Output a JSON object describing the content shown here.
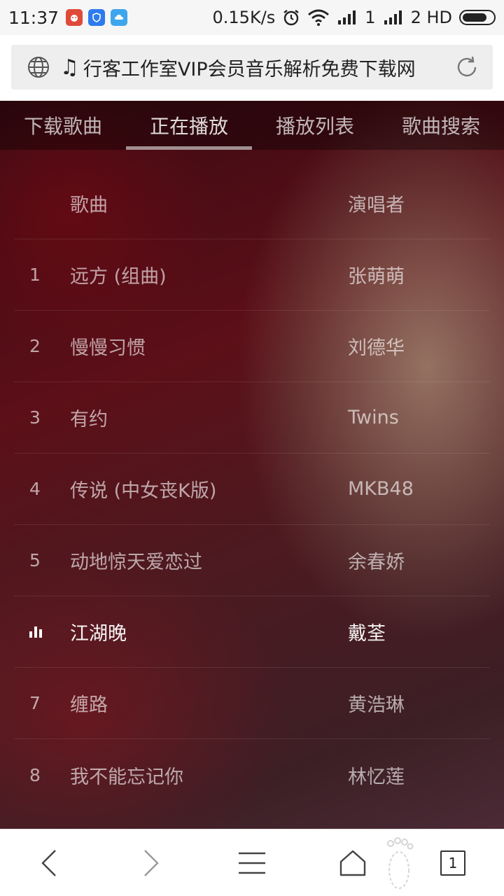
{
  "status_bar": {
    "time": "11:37",
    "net_speed": "0.15K/s",
    "sim1": "1",
    "sim2": "2 HD"
  },
  "address_bar": {
    "title": "行客工作室VIP会员音乐解析免费下载网"
  },
  "tabs": [
    {
      "label": "下载歌曲",
      "active": false
    },
    {
      "label": "正在播放",
      "active": true
    },
    {
      "label": "播放列表",
      "active": false
    },
    {
      "label": "歌曲搜索",
      "active": false
    }
  ],
  "table": {
    "header": {
      "song": "歌曲",
      "artist": "演唱者"
    },
    "rows": [
      {
        "num": "1",
        "song": "远方 (组曲)",
        "artist": "张萌萌"
      },
      {
        "num": "2",
        "song": "慢慢习惯",
        "artist": "刘德华"
      },
      {
        "num": "3",
        "song": "有约",
        "artist": "Twins"
      },
      {
        "num": "4",
        "song": "传说 (中女丧K版)",
        "artist": "MKB48"
      },
      {
        "num": "5",
        "song": "动地惊天爱恋过",
        "artist": "余春娇"
      },
      {
        "num": "",
        "song": "江湖晚",
        "artist": "戴荃",
        "playing": true
      },
      {
        "num": "7",
        "song": "缠路",
        "artist": "黄浩琳"
      },
      {
        "num": "8",
        "song": "我不能忘记你",
        "artist": "林忆莲"
      }
    ]
  },
  "bottom_nav": {
    "tab_count": "1"
  },
  "colors": {
    "accent_underline": "#cfc7c8",
    "bg_dark": "#5c0f18",
    "playing_text": "#ffffff"
  }
}
